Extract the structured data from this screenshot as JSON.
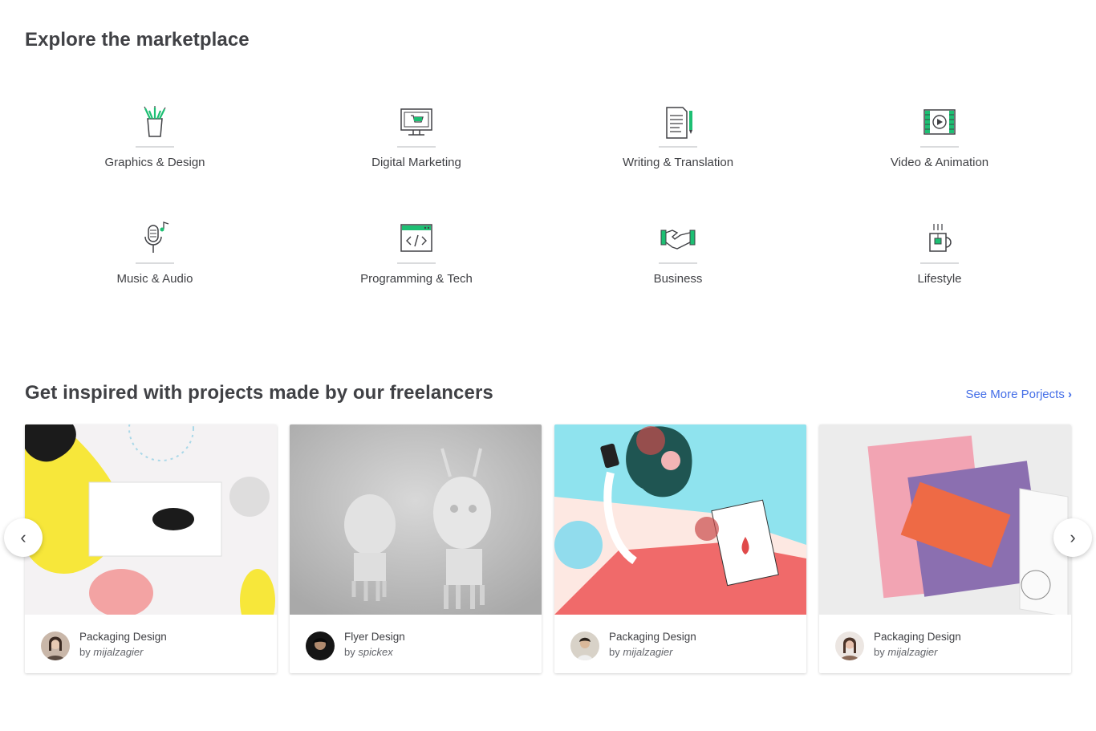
{
  "marketplace": {
    "title": "Explore the marketplace",
    "categories": [
      {
        "label": "Graphics & Design",
        "icon": "pencil-cup-icon"
      },
      {
        "label": "Digital Marketing",
        "icon": "monitor-cart-icon"
      },
      {
        "label": "Writing & Translation",
        "icon": "document-pen-icon"
      },
      {
        "label": "Video & Animation",
        "icon": "film-play-icon"
      },
      {
        "label": "Music & Audio",
        "icon": "microphone-note-icon"
      },
      {
        "label": "Programming & Tech",
        "icon": "code-window-icon"
      },
      {
        "label": "Business",
        "icon": "handshake-icon"
      },
      {
        "label": "Lifestyle",
        "icon": "mug-icon"
      }
    ]
  },
  "inspire": {
    "title": "Get inspired with projects made by our freelancers",
    "see_more": "See More Porjects",
    "by_prefix": "by",
    "cards": [
      {
        "title": "Packaging Design",
        "author": "mijalzagier"
      },
      {
        "title": "Flyer Design",
        "author": "spickex"
      },
      {
        "title": "Packaging Design",
        "author": "mijalzagier"
      },
      {
        "title": "Packaging Design",
        "author": "mijalzagier"
      }
    ]
  },
  "carousel": {
    "prev": "‹",
    "next": "›"
  },
  "colors": {
    "accent_green": "#1dbf73",
    "link_blue": "#446ee7",
    "text": "#404145"
  }
}
